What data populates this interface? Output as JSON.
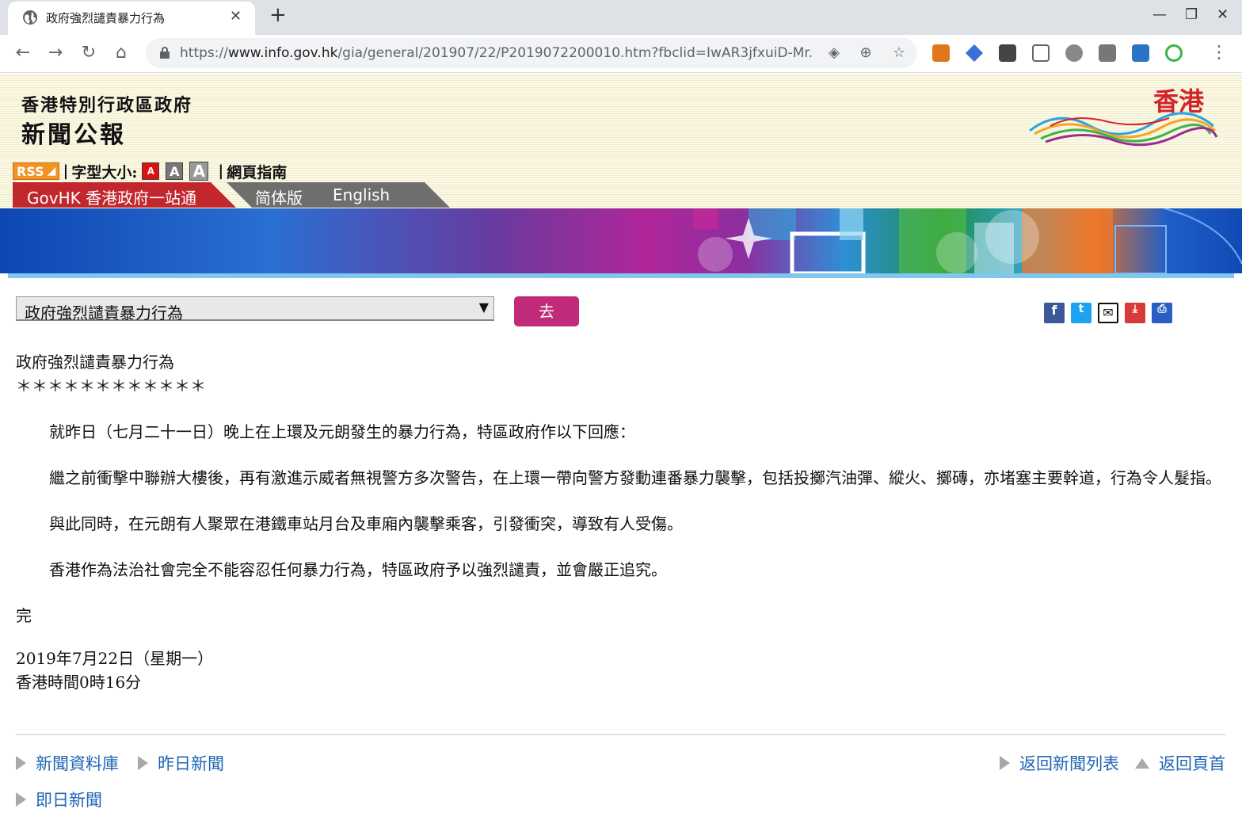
{
  "browser": {
    "tab_title": "政府強烈譴責暴力行為",
    "url_scheme": "https://",
    "url_host": "www.info.gov.hk",
    "url_path": "/gia/general/201907/22/P2019072200010.htm?fbclid=IwAR3jfxuiD-Mr..."
  },
  "header": {
    "gov_name": "香港特別行政區政府",
    "press_title": "新聞公報",
    "logo_text": "香港",
    "rss_label": "RSS",
    "font_size_label": "字型大小:",
    "font_sizes": [
      "A",
      "A",
      "A"
    ],
    "site_guide": "網頁指南",
    "govhk_tab": "GovHK 香港政府一站通",
    "simplified": "简体版",
    "english": "English"
  },
  "controls": {
    "selected_title": "政府強烈譴責暴力行為",
    "go_label": "去"
  },
  "article": {
    "title": "政府強烈譴責暴力行為",
    "stars": "＊＊＊＊＊＊＊＊＊＊＊＊",
    "paragraphs": [
      "就昨日（七月二十一日）晚上在上環及元朗發生的暴力行為，特區政府作以下回應：",
      "繼之前衝擊中聯辦大樓後，再有激進示威者無視警方多次警告，在上環一帶向警方發動連番暴力襲擊，包括投擲汽油彈、縱火、擲磚，亦堵塞主要幹道，行為令人髮指。",
      "與此同時，在元朗有人聚眾在港鐵車站月台及車廂內襲擊乘客，引發衝突，導致有人受傷。",
      "香港作為法治社會完全不能容忍任何暴力行為，特區政府予以強烈譴責，並會嚴正追究。"
    ],
    "end_mark": "完",
    "date": "2019年7月22日（星期一）",
    "time": "香港時間0時16分"
  },
  "footer": {
    "archive": "新聞資料庫",
    "yesterday": "昨日新聞",
    "back_list": "返回新聞列表",
    "back_top": "返回頁首",
    "today": "即日新聞"
  },
  "colors": {
    "go_button": "#c02a78",
    "govhk_tab": "#c1272d",
    "link": "#1f65b5"
  }
}
